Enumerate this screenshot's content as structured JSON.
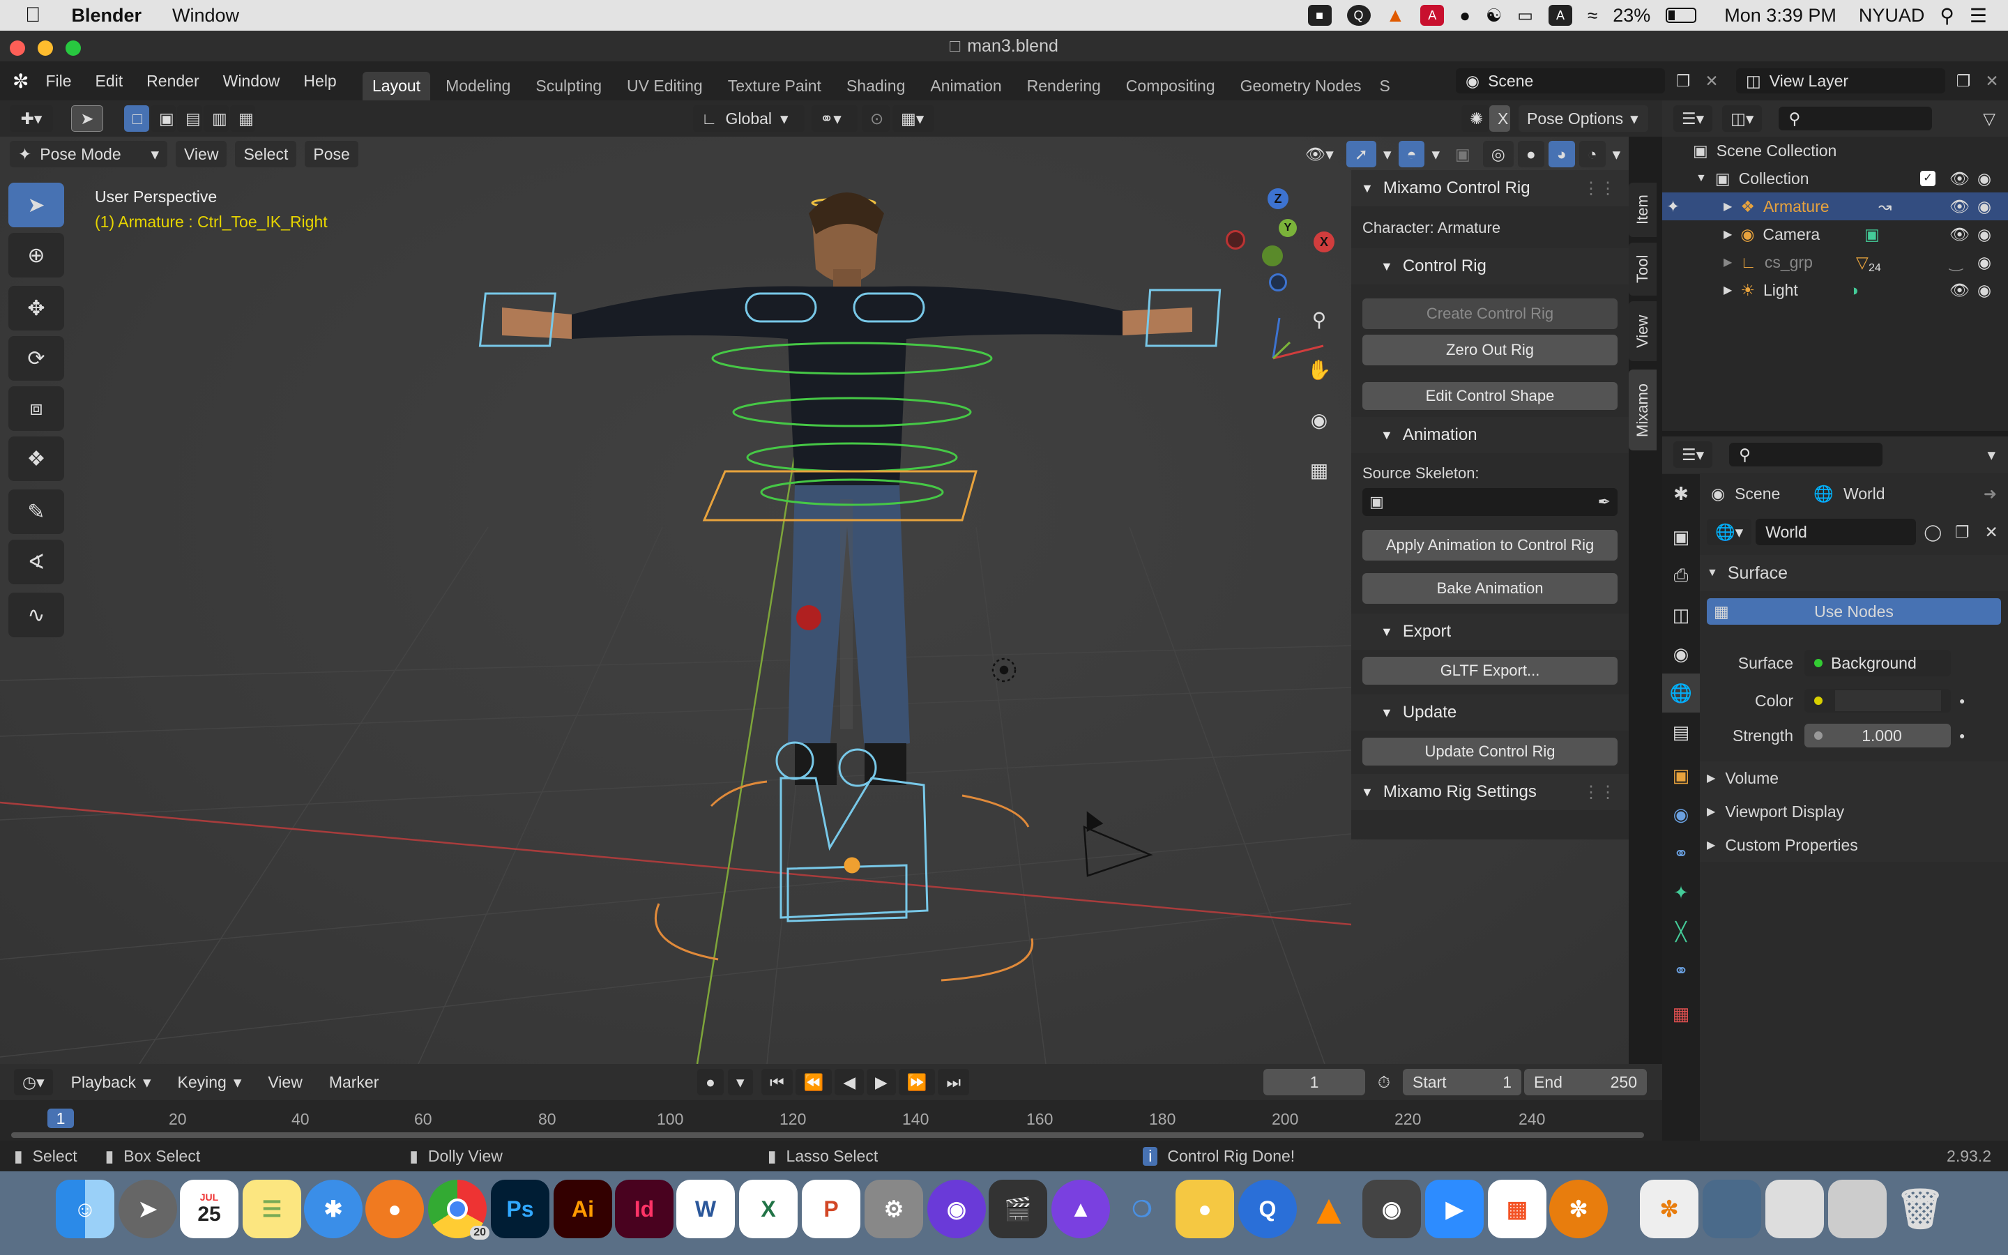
{
  "mac_menubar": {
    "app_name": "Blender",
    "menu_window": "Window",
    "battery": "23%",
    "clock": "Mon 3:39 PM",
    "user": "NYUAD"
  },
  "window": {
    "title": "man3.blend"
  },
  "topbar": {
    "menus": [
      "File",
      "Edit",
      "Render",
      "Window",
      "Help"
    ],
    "workspaces": [
      "Layout",
      "Modeling",
      "Sculpting",
      "UV Editing",
      "Texture Paint",
      "Shading",
      "Animation",
      "Rendering",
      "Compositing",
      "Geometry Nodes",
      "S"
    ],
    "active_workspace": "Layout",
    "scene": "Scene",
    "view_layer": "View Layer"
  },
  "viewport_header": {
    "transform_orientation": "Global",
    "pose_options": "Pose Options",
    "mode": "Pose Mode",
    "menus": [
      "View",
      "Select",
      "Pose"
    ]
  },
  "viewport": {
    "perspective_label": "User Perspective",
    "active_info": "(1) Armature : Ctrl_Toe_IK_Right",
    "gizmo": {
      "x": "X",
      "y": "Y",
      "z": "Z"
    }
  },
  "npanel": {
    "title": "Mixamo Control Rig",
    "character_label": "Character: Armature",
    "control_rig_header": "Control Rig",
    "create_control_rig": "Create Control Rig",
    "zero_out_rig": "Zero Out Rig",
    "edit_control_shape": "Edit Control Shape",
    "animation_header": "Animation",
    "source_skeleton_label": "Source Skeleton:",
    "apply_animation": "Apply Animation to Control Rig",
    "bake_animation": "Bake Animation",
    "export_header": "Export",
    "gltf_export": "GLTF Export...",
    "update_header": "Update",
    "update_control_rig": "Update Control Rig",
    "settings_header": "Mixamo Rig Settings",
    "tabs": [
      "Item",
      "Tool",
      "View",
      "Mixamo"
    ]
  },
  "outliner": {
    "root": "Scene Collection",
    "collection": "Collection",
    "items": [
      {
        "label": "Armature",
        "selected": true
      },
      {
        "label": "Camera",
        "selected": false
      },
      {
        "label": "cs_grp",
        "selected": false,
        "badge": "24"
      },
      {
        "label": "Light",
        "selected": false
      }
    ]
  },
  "properties": {
    "breadcrumb_scene": "Scene",
    "breadcrumb_world": "World",
    "world_name": "World",
    "surface_header": "Surface",
    "use_nodes": "Use Nodes",
    "surface_label": "Surface",
    "surface_value": "Background",
    "color_label": "Color",
    "strength_label": "Strength",
    "strength_value": "1.000",
    "collapsed_sections": [
      "Volume",
      "Viewport Display",
      "Custom Properties"
    ]
  },
  "timeline": {
    "menus": [
      "Playback",
      "Keying",
      "View",
      "Marker"
    ],
    "current_frame": "1",
    "start_label": "Start",
    "start_value": "1",
    "end_label": "End",
    "end_value": "250",
    "ruler": [
      "1",
      "20",
      "40",
      "60",
      "80",
      "100",
      "120",
      "140",
      "160",
      "180",
      "200",
      "220",
      "240"
    ]
  },
  "statusbar": {
    "select": "Select",
    "box_select": "Box Select",
    "dolly_view": "Dolly View",
    "lasso_select": "Lasso Select",
    "report": "Control Rig Done!",
    "version": "2.93.2"
  },
  "dock": {
    "calendar_month": "JUL",
    "calendar_day": "25",
    "ps": "Ps",
    "ai": "Ai",
    "id": "Id",
    "word": "W",
    "excel": "X",
    "ppt": "P",
    "chrome_badge": "20"
  },
  "colors": {
    "accent": "#4772b3",
    "active_text": "#e8a33d",
    "info_yellow": "#e6d400",
    "selection_row": "#334d80"
  }
}
